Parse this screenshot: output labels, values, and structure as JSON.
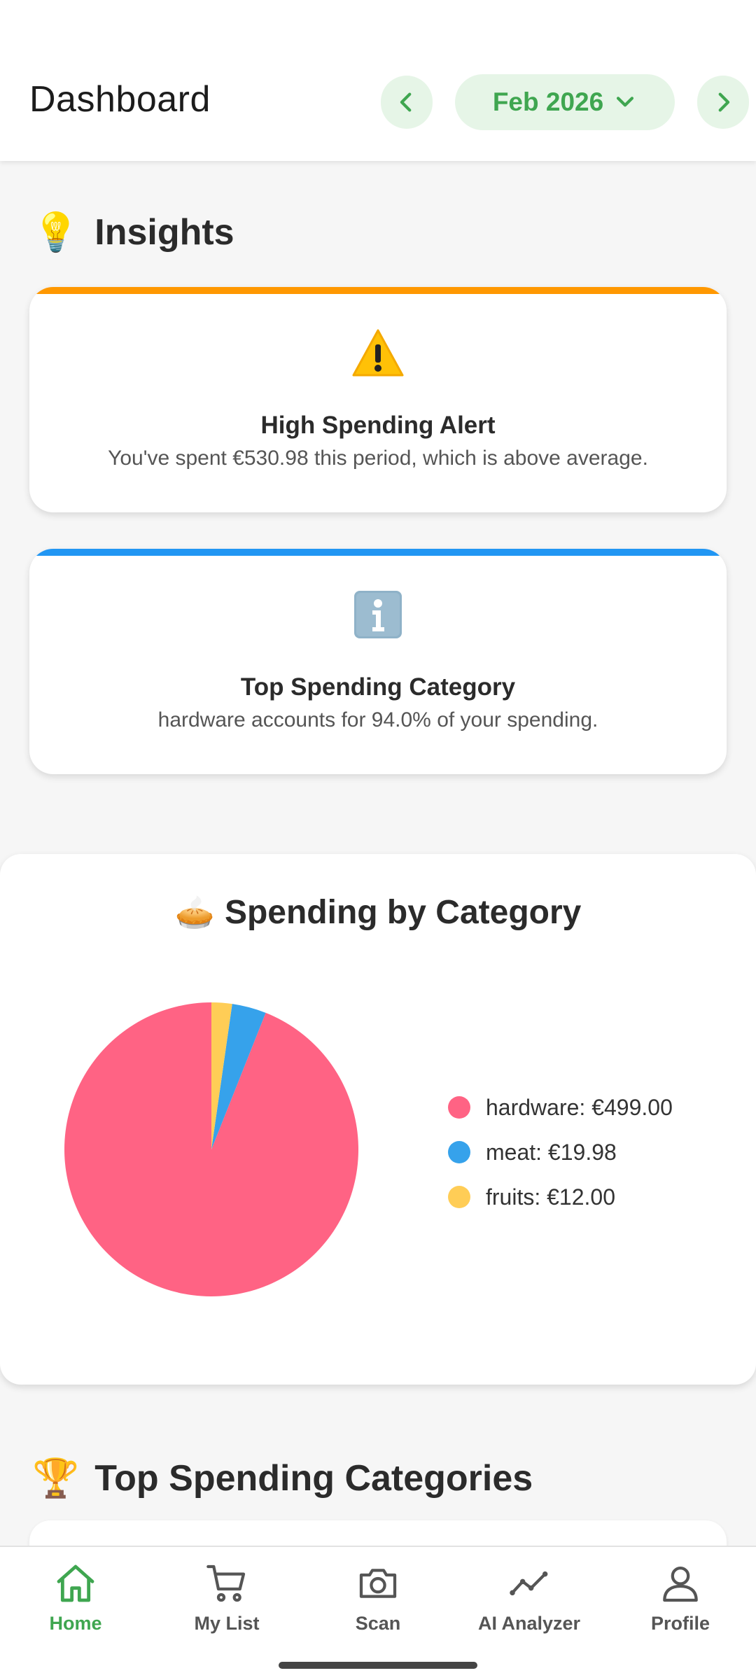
{
  "header": {
    "title": "Dashboard",
    "period": "Feb 2026",
    "accent_color": "#3fa650",
    "icons": {
      "prev": "chevron-left-icon",
      "next": "chevron-right-icon",
      "period_dropdown": "chevron-down-icon"
    }
  },
  "insights": {
    "title": "Insights",
    "title_icon": "lightbulb-icon",
    "cards": [
      {
        "title": "High Spending Alert",
        "text": "You've spent €530.98 this period, which is above average.",
        "icon": "warning-icon",
        "accent_color": "#ff9800"
      },
      {
        "title": "Top Spending Category",
        "text": "hardware accounts for 94.0% of your spending.",
        "icon": "info-icon",
        "accent_color": "#2196f3"
      }
    ]
  },
  "spending_chart": {
    "title": "Spending by Category",
    "title_icon": "pie-icon",
    "legend": [
      {
        "label": "hardware: €499.00",
        "color": "#ff6384"
      },
      {
        "label": "meat: €19.98",
        "color": "#36a2eb"
      },
      {
        "label": "fruits: €12.00",
        "color": "#ffcd56"
      }
    ]
  },
  "chart_data": {
    "type": "pie",
    "title": "Spending by Category",
    "categories": [
      "hardware",
      "meat",
      "fruits"
    ],
    "values": [
      499.0,
      19.98,
      12.0
    ],
    "colors": [
      "#ff6384",
      "#36a2eb",
      "#ffcd56"
    ],
    "legend_position": "right"
  },
  "top_categories": {
    "title": "Top Spending Categories",
    "title_icon": "trophy-icon"
  },
  "bottom_nav": {
    "active": "Home",
    "tabs": [
      {
        "label": "Home",
        "icon": "home-icon"
      },
      {
        "label": "My List",
        "icon": "cart-icon"
      },
      {
        "label": "Scan",
        "icon": "camera-icon"
      },
      {
        "label": "AI Analyzer",
        "icon": "trend-icon"
      },
      {
        "label": "Profile",
        "icon": "person-icon"
      }
    ]
  }
}
